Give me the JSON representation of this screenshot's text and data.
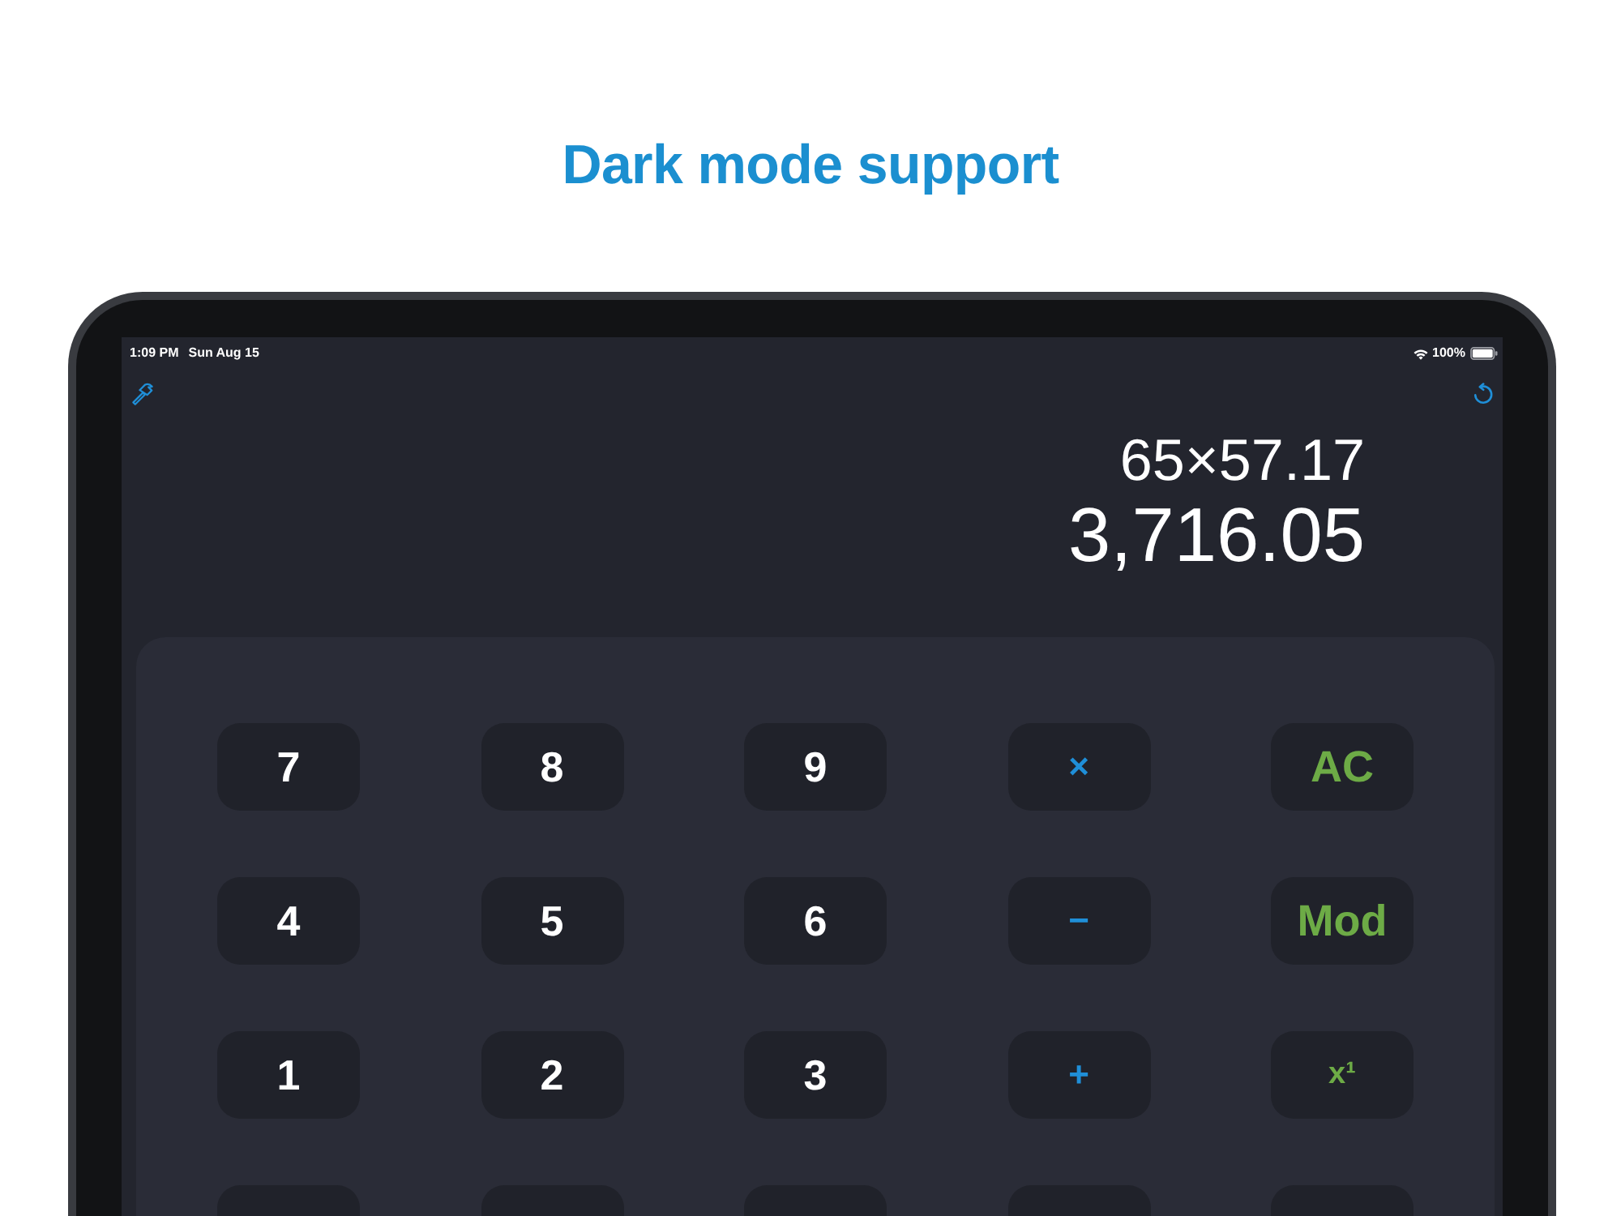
{
  "headline": "Dark mode support",
  "status_bar": {
    "time": "1:09 PM",
    "date": "Sun Aug 15",
    "battery": "100%"
  },
  "display": {
    "expression": "65×57.17",
    "result": "3,716.05"
  },
  "keypad": {
    "rows": [
      [
        {
          "label": "7",
          "kind": "digit"
        },
        {
          "label": "8",
          "kind": "digit"
        },
        {
          "label": "9",
          "kind": "digit"
        },
        {
          "label": "×",
          "kind": "operator"
        },
        {
          "label": "AC",
          "kind": "function"
        }
      ],
      [
        {
          "label": "4",
          "kind": "digit"
        },
        {
          "label": "5",
          "kind": "digit"
        },
        {
          "label": "6",
          "kind": "digit"
        },
        {
          "label": "−",
          "kind": "operator"
        },
        {
          "label": "Mod",
          "kind": "function"
        }
      ],
      [
        {
          "label": "1",
          "kind": "digit"
        },
        {
          "label": "2",
          "kind": "digit"
        },
        {
          "label": "3",
          "kind": "digit"
        },
        {
          "label": "+",
          "kind": "operator"
        },
        {
          "label": "x¹",
          "kind": "power"
        }
      ],
      [
        {
          "kind": "blank"
        },
        {
          "kind": "blank"
        },
        {
          "kind": "blank"
        },
        {
          "kind": "blank"
        },
        {
          "kind": "blank"
        }
      ]
    ]
  }
}
